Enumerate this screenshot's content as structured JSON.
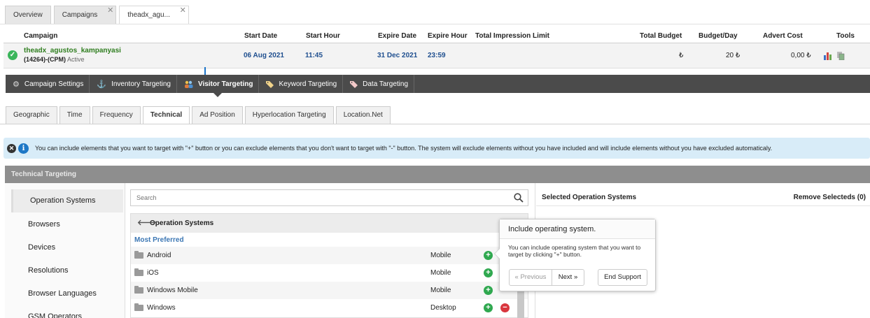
{
  "top_tabs": [
    {
      "label": "Overview"
    },
    {
      "label": "Campaigns",
      "close": "✕"
    },
    {
      "label": "theadx_agu...",
      "close": "✕"
    }
  ],
  "campaign_table": {
    "headers": {
      "campaign": "Campaign",
      "start_date": "Start Date",
      "start_hour": "Start Hour",
      "expire_date": "Expire Date",
      "expire_hour": "Expire Hour",
      "total_impression_limit": "Total Impression Limit",
      "total_budget": "Total Budget",
      "budget_day": "Budget/Day",
      "advert_cost": "Advert Cost",
      "tools": "Tools"
    },
    "row": {
      "name": "theadx_agustos_kampanyasi",
      "id_type": "(14264)-(CPM)",
      "status": "Active",
      "start_date": "06 Aug 2021",
      "start_hour": "11:45",
      "expire_date": "31 Dec 2021",
      "expire_hour": "23:59",
      "total_budget": "₺",
      "budget_day": "20 ₺",
      "advert_cost": "0,00 ₺"
    }
  },
  "nav": [
    {
      "label": "Campaign Settings",
      "icon": "gear-icon"
    },
    {
      "label": "Inventory Targeting",
      "icon": "anchor-icon"
    },
    {
      "label": "Visitor Targeting",
      "icon": "people-icon",
      "active": true
    },
    {
      "label": "Keyword Targeting",
      "icon": "tag-icon"
    },
    {
      "label": "Data Targeting",
      "icon": "tag-icon"
    }
  ],
  "sub_tabs": [
    {
      "label": "Geographic"
    },
    {
      "label": "Time"
    },
    {
      "label": "Frequency"
    },
    {
      "label": "Technical",
      "active": true
    },
    {
      "label": "Ad Position"
    },
    {
      "label": "Hyperlocation Targeting"
    },
    {
      "label": "Location.Net"
    }
  ],
  "info_text": "You can include elements that you want to target with \"+\" button or you can exclude elements that you don't want to target with \"-\" button. The system will exclude elements without you have included and will include elements without you have excluded automaticaly.",
  "panel_title": "Technical Targeting",
  "left_menu": [
    "Operation Systems",
    "Browsers",
    "Devices",
    "Resolutions",
    "Browser Languages",
    "GSM Operators"
  ],
  "search": {
    "placeholder": "Search"
  },
  "list": {
    "title": "Operation Systems",
    "section": "Most Preferred",
    "items": [
      {
        "name": "Android",
        "type": "Mobile"
      },
      {
        "name": "iOS",
        "type": "Mobile"
      },
      {
        "name": "Windows Mobile",
        "type": "Mobile"
      },
      {
        "name": "Windows",
        "type": "Desktop"
      }
    ]
  },
  "selected": {
    "title": "Selected Operation Systems",
    "remove": "Remove Selecteds (0)"
  },
  "tooltip": {
    "title": "Include operating system.",
    "body": "You can include operating system that you want to target by clicking \"+\" button.",
    "prev": "« Previous",
    "next": "Next »",
    "end": "End Support"
  },
  "colors": {
    "accent_green": "#2fa84f",
    "danger_red": "#d9363e",
    "link_blue": "#1f4f8f",
    "nav_bg": "#4b4b4b"
  }
}
